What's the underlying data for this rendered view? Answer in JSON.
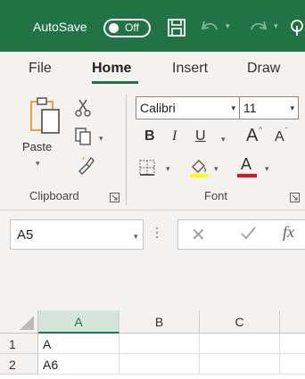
{
  "titlebar": {
    "autosave_label": "AutoSave",
    "autosave_state": "Off",
    "icons": [
      "save-icon",
      "undo-icon",
      "redo-icon"
    ]
  },
  "tabs": [
    {
      "label": "File",
      "active": false
    },
    {
      "label": "Home",
      "active": true
    },
    {
      "label": "Insert",
      "active": false
    },
    {
      "label": "Draw",
      "active": false
    }
  ],
  "ribbon": {
    "clipboard": {
      "paste_label": "Paste",
      "group_label": "Clipboard",
      "icons": [
        "paste-icon",
        "cut-icon",
        "copy-icon",
        "format-painter-icon",
        "dialog-launcher-icon"
      ]
    },
    "font": {
      "font_name": "Calibri",
      "font_size": "11",
      "bold": "B",
      "italic": "I",
      "underline": "U",
      "grow": "A",
      "shrink": "A",
      "font_color_letter": "A",
      "group_label": "Font",
      "font_color": "#e81123",
      "fill_color": "#ffff00",
      "icons": [
        "borders-icon",
        "fill-color-icon",
        "font-color-icon",
        "dialog-launcher-icon"
      ]
    }
  },
  "formula_bar": {
    "name_box": "A5",
    "fx_label": "fx",
    "icons": [
      "cancel-icon",
      "enter-icon",
      "insert-function-icon"
    ]
  },
  "grid": {
    "columns": [
      "A",
      "B",
      "C"
    ],
    "selected_column": "A",
    "rows": [
      {
        "number": "1",
        "cells": [
          "A",
          "",
          ""
        ]
      },
      {
        "number": "2",
        "cells": [
          "A6",
          "",
          ""
        ]
      }
    ]
  },
  "colors": {
    "accent": "#217346",
    "ribbon_bg": "#f3f2f1"
  }
}
